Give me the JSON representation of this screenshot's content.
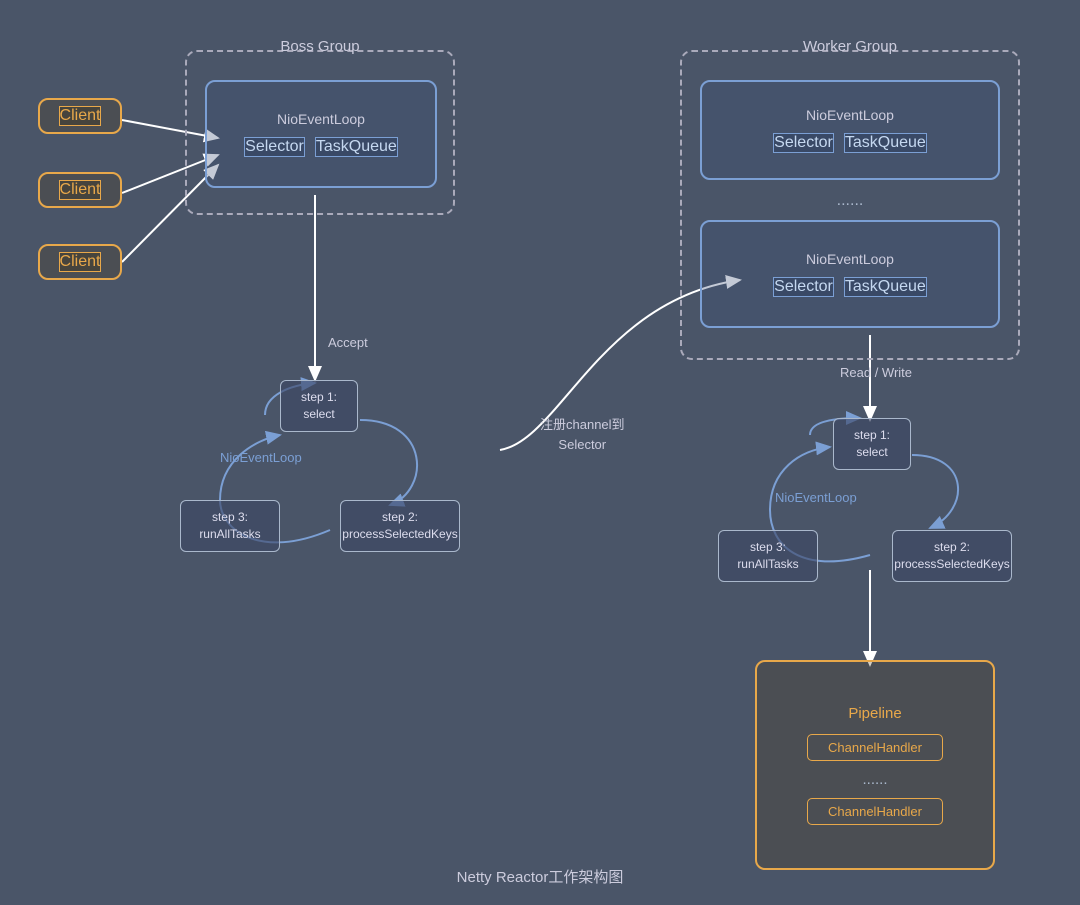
{
  "title": "Netty Reactor工作架构图",
  "boss_group": {
    "label": "Boss Group",
    "nio_label": "NioEventLoop",
    "selector": "Selector",
    "task_queue": "TaskQueue"
  },
  "worker_group": {
    "label": "Worker Group",
    "nio_label": "NioEventLoop",
    "selector": "Selector",
    "task_queue": "TaskQueue",
    "ellipsis": "......",
    "nio_label2": "NioEventLoop",
    "selector2": "Selector",
    "task_queue2": "TaskQueue"
  },
  "clients": [
    "Client",
    "Client",
    "Client"
  ],
  "boss_loop": {
    "label": "NioEventLoop",
    "step1": "step 1:\nselect",
    "step2": "step 2:\nprocessSelectedKeys",
    "step3": "step 3:\nrunAllTasks"
  },
  "worker_loop": {
    "label": "NioEventLoop",
    "step1": "step 1:\nselect",
    "step2": "step 2:\nprocessSelectedKeys",
    "step3": "step 3:\nrunAllTasks"
  },
  "pipeline": {
    "label": "Pipeline",
    "handler1": "ChannelHandler",
    "ellipsis": "......",
    "handler2": "ChannelHandler"
  },
  "arrows": {
    "accept_label": "Accept",
    "register_label": "注册channel到\nSelector",
    "readwrite_label": "Read / Write"
  }
}
